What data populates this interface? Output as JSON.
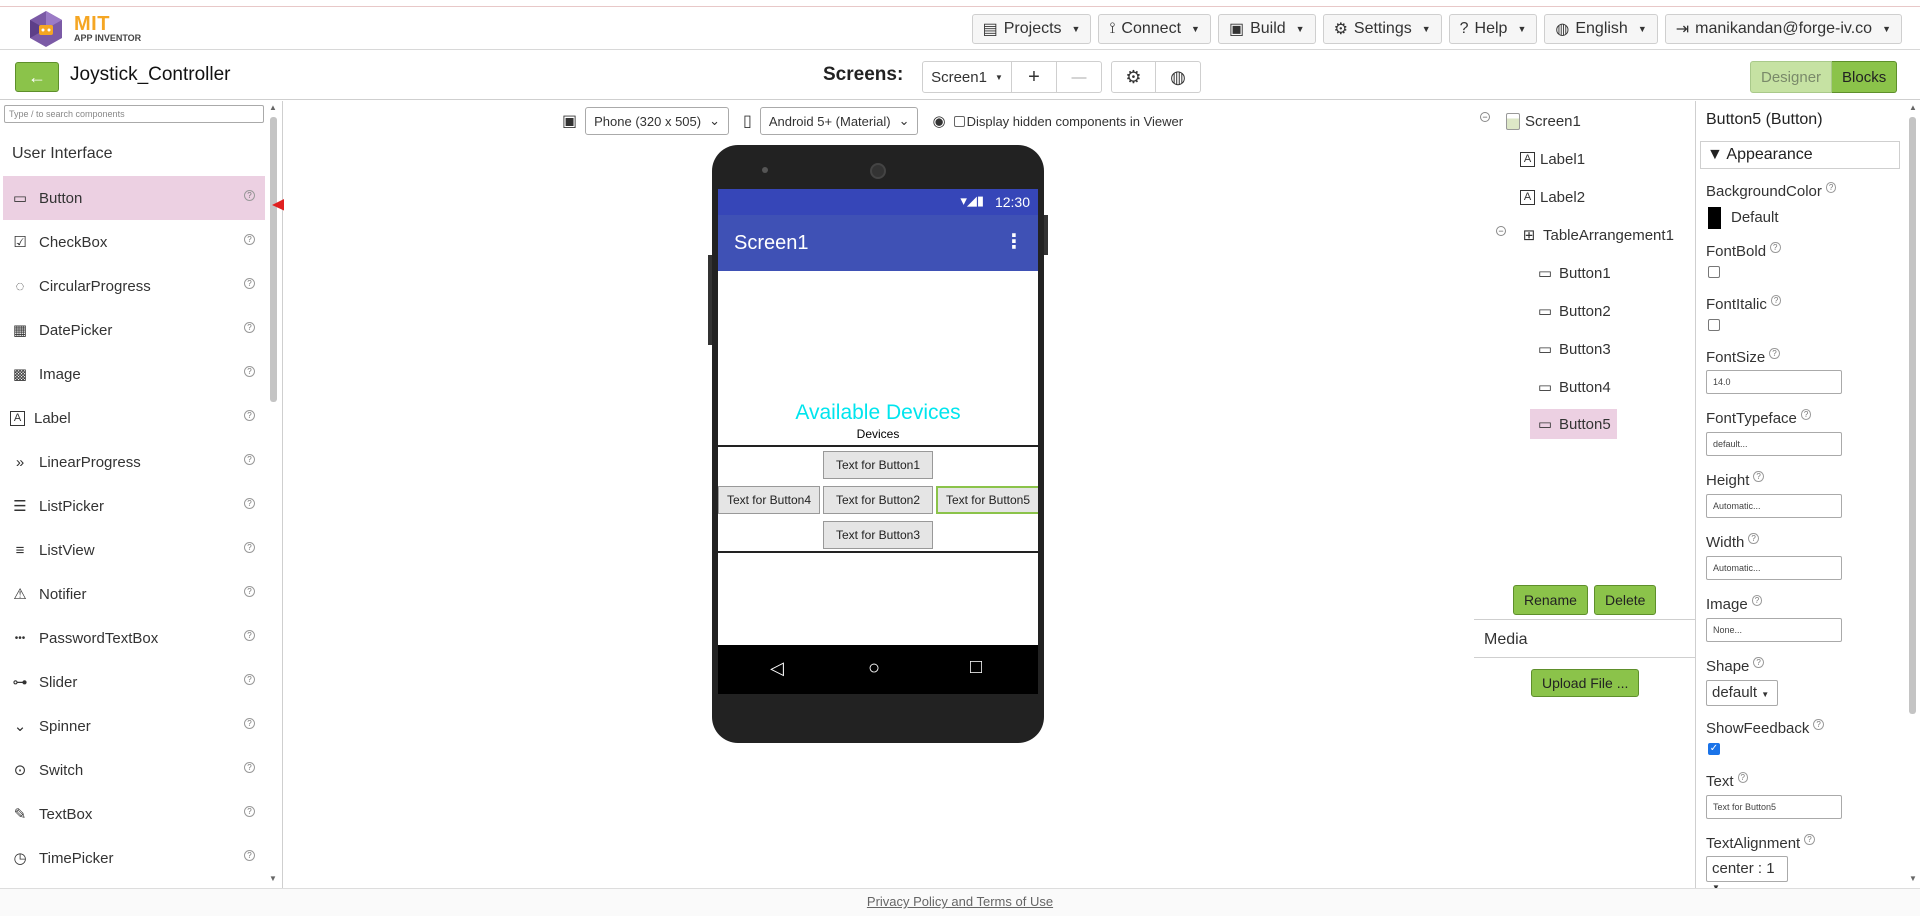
{
  "app": {
    "brand_top": "MIT",
    "brand_sub": "APP INVENTOR"
  },
  "topmenu": [
    {
      "label": "Projects",
      "icon": "folder-icon"
    },
    {
      "label": "Connect",
      "icon": "antenna-icon"
    },
    {
      "label": "Build",
      "icon": "build-icon"
    },
    {
      "label": "Settings",
      "icon": "gear-icon"
    },
    {
      "label": "Help",
      "icon": "help-icon"
    },
    {
      "label": "English",
      "icon": "globe-icon"
    },
    {
      "label": "manikandan@forge-iv.co",
      "icon": "logout-icon"
    }
  ],
  "project": {
    "back_label": "←",
    "name": "Joystick_Controller",
    "screens_label": "Screens:",
    "screen_select": "Screen1",
    "add_label": "+",
    "remove_label": "—",
    "designer_label": "Designer",
    "blocks_label": "Blocks"
  },
  "palette": {
    "search_placeholder": "Type / to search components",
    "category": "User Interface",
    "items": [
      {
        "label": "Button",
        "icon": "button-icon"
      },
      {
        "label": "CheckBox",
        "icon": "checkbox-icon"
      },
      {
        "label": "CircularProgress",
        "icon": "circular-progress-icon"
      },
      {
        "label": "DatePicker",
        "icon": "calendar-icon"
      },
      {
        "label": "Image",
        "icon": "image-icon"
      },
      {
        "label": "Label",
        "icon": "label-icon"
      },
      {
        "label": "LinearProgress",
        "icon": "chevrons-icon"
      },
      {
        "label": "ListPicker",
        "icon": "list-icon"
      },
      {
        "label": "ListView",
        "icon": "list-view-icon"
      },
      {
        "label": "Notifier",
        "icon": "warning-icon"
      },
      {
        "label": "PasswordTextBox",
        "icon": "password-icon"
      },
      {
        "label": "Slider",
        "icon": "slider-icon"
      },
      {
        "label": "Spinner",
        "icon": "spinner-icon"
      },
      {
        "label": "Switch",
        "icon": "switch-icon"
      },
      {
        "label": "TextBox",
        "icon": "textbox-icon"
      },
      {
        "label": "TimePicker",
        "icon": "clock-icon"
      }
    ]
  },
  "viewer": {
    "size_select": "Phone (320 x 505)",
    "theme_select": "Android 5+ (Material)",
    "hidden_label": "Display hidden components in Viewer",
    "status_time": "12:30",
    "screen_title": "Screen1",
    "label1": "Available Devices",
    "label2": "Devices",
    "buttons": {
      "b1": "Text for Button1",
      "b2": "Text for Button2",
      "b3": "Text for Button3",
      "b4": "Text for Button4",
      "b5": "Text for Button5"
    }
  },
  "tree": {
    "nodes": [
      "Screen1",
      "Label1",
      "Label2",
      "TableArrangement1",
      "Button1",
      "Button2",
      "Button3",
      "Button4",
      "Button5"
    ],
    "rename_label": "Rename",
    "delete_label": "Delete",
    "media_label": "Media",
    "upload_label": "Upload File ..."
  },
  "props": {
    "title": "Button5 (Button)",
    "section": "Appearance",
    "bgcolor_label": "BackgroundColor",
    "bgcolor_value": "Default",
    "fontbold_label": "FontBold",
    "fontitalic_label": "FontItalic",
    "fontsize_label": "FontSize",
    "fontsize_value": "14.0",
    "typeface_label": "FontTypeface",
    "typeface_value": "default...",
    "height_label": "Height",
    "height_value": "Automatic...",
    "width_label": "Width",
    "width_value": "Automatic...",
    "image_label": "Image",
    "image_value": "None...",
    "shape_label": "Shape",
    "shape_value": "default",
    "feedback_label": "ShowFeedback",
    "text_label": "Text",
    "text_value": "Text for Button5",
    "align_label": "TextAlignment",
    "align_value": "center : 1"
  },
  "footer": {
    "link": "Privacy Policy and Terms of Use"
  },
  "colors": {
    "accent_green": "#8bc34a",
    "selection_pink": "#ecd0e2",
    "app_bar": "#3f51b5",
    "label_cyan": "#00e5ee",
    "arrow_red": "#e02020"
  }
}
